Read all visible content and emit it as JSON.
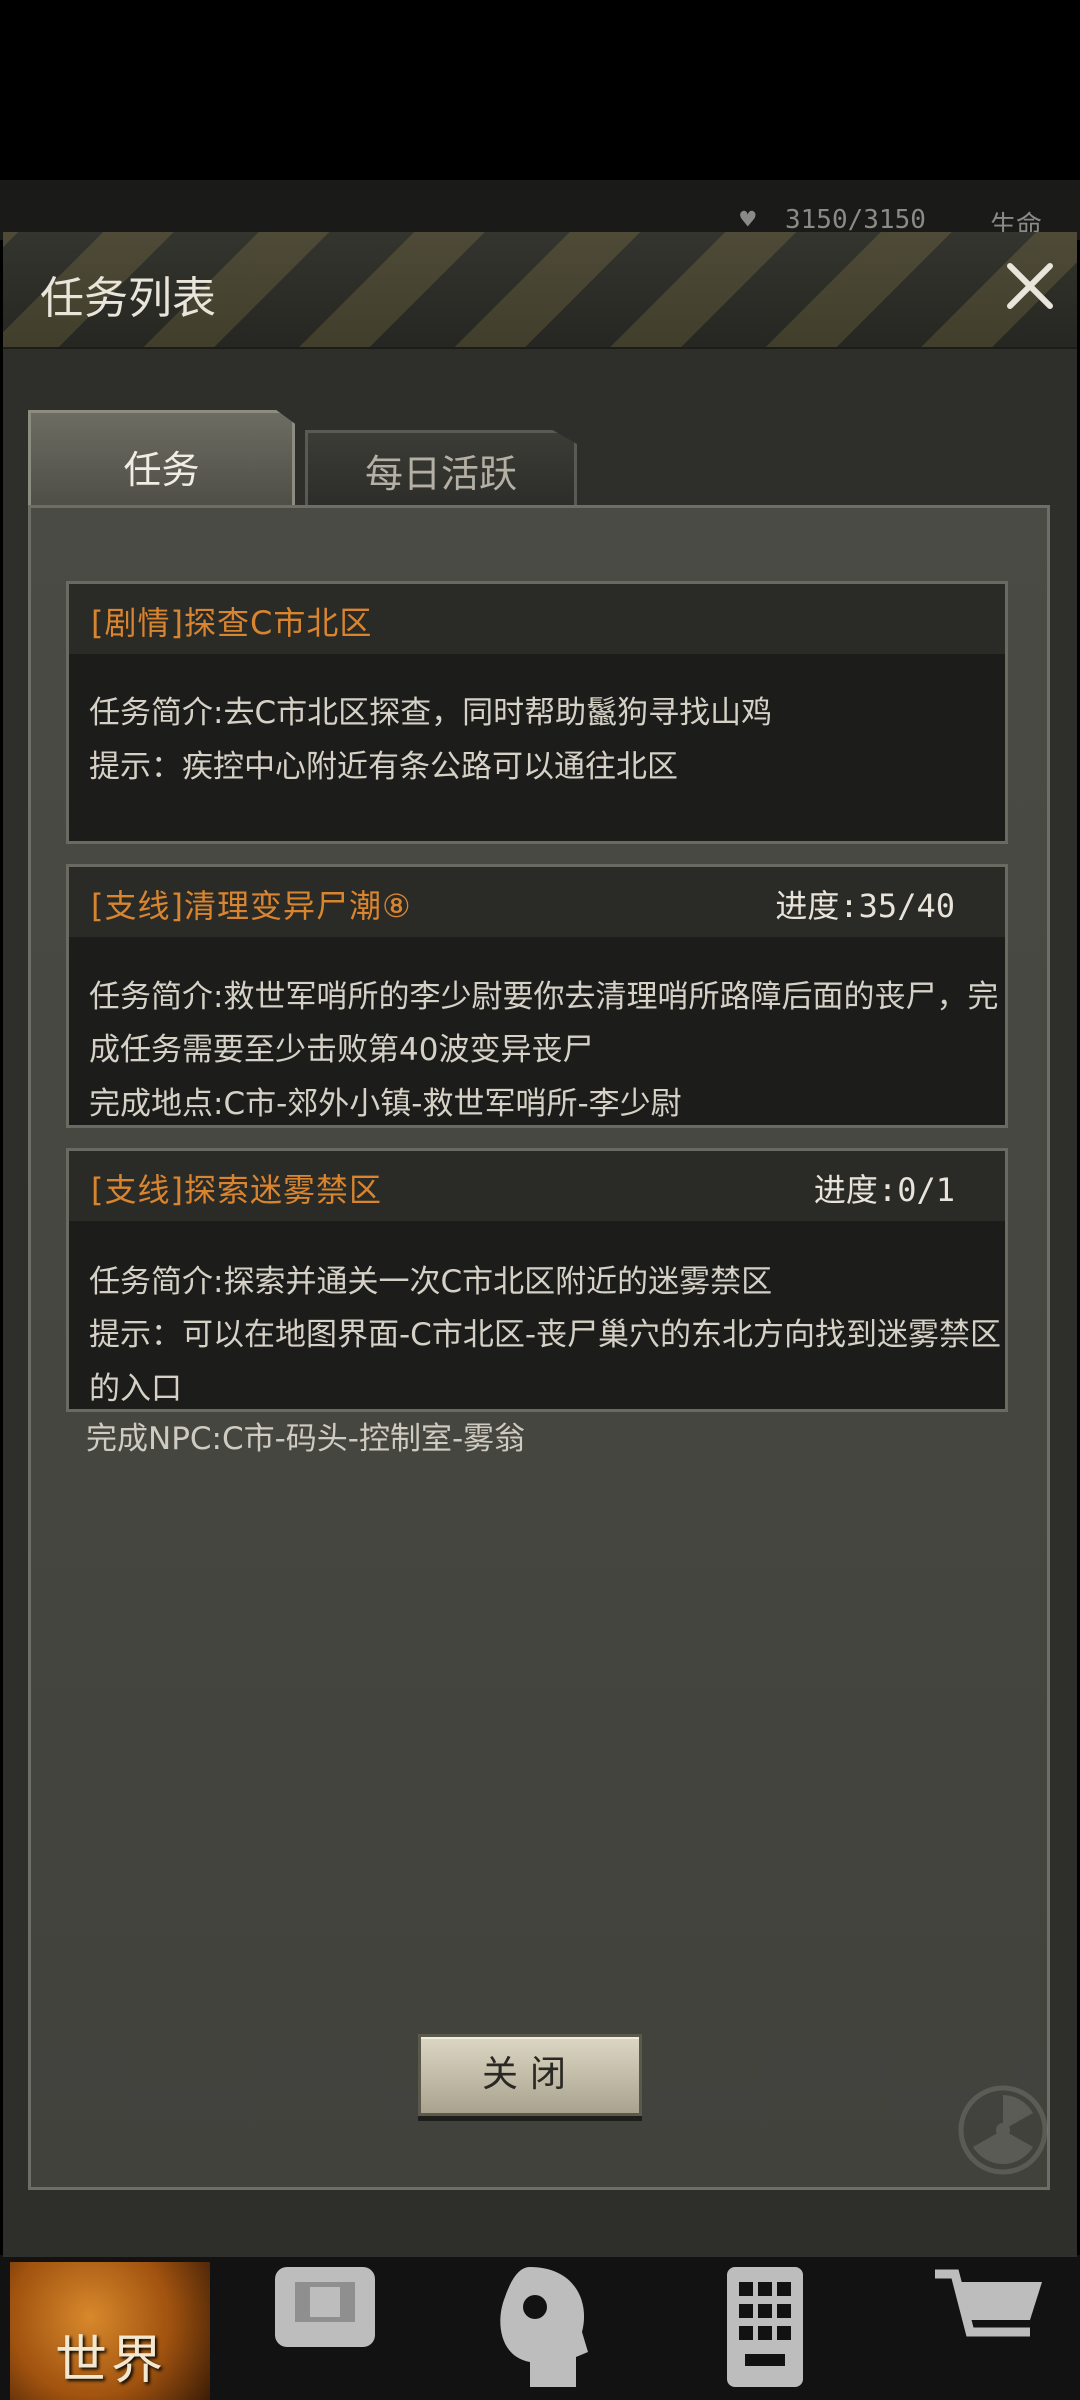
{
  "hud": {
    "hp": "3150/3150",
    "label": "生命"
  },
  "dialog": {
    "title": "任务列表"
  },
  "tabs": [
    {
      "label": "任务",
      "active": true
    },
    {
      "label": "每日活跃",
      "active": false
    }
  ],
  "quests": [
    {
      "title": "[剧情]探查C市北区",
      "progress": "",
      "lines": [
        "任务简介:去C市北区探查，同时帮助鬣狗寻找山鸡",
        "提示：疾控中心附近有条公路可以通往北区"
      ]
    },
    {
      "title": "[支线]清理变异尸潮⑧",
      "progress": "进度:35/40",
      "lines": [
        "任务简介:救世军哨所的李少尉要你去清理哨所路障后面的丧尸，完",
        "成任务需要至少击败第40波变异丧尸",
        "完成地点:C市-郊外小镇-救世军哨所-李少尉"
      ]
    },
    {
      "title": "[支线]探索迷雾禁区",
      "progress": "进度:0/1",
      "lines": [
        "任务简介:探索并通关一次C市北区附近的迷雾禁区",
        "提示：可以在地图界面-C市北区-丧尸巢穴的东北方向找到迷雾禁区",
        "的入口"
      ]
    }
  ],
  "overflow_line": "完成NPC:C市-码头-控制室-雾翁",
  "close_button": "关闭",
  "nav": {
    "world_label": "世界",
    "icons": [
      "backpack-icon",
      "character-head-icon",
      "phone-icon",
      "shopping-cart-icon"
    ]
  },
  "colors": {
    "quest_title": "#d9852f",
    "text": "#d5d1c6",
    "panel": "#4b4b45"
  }
}
